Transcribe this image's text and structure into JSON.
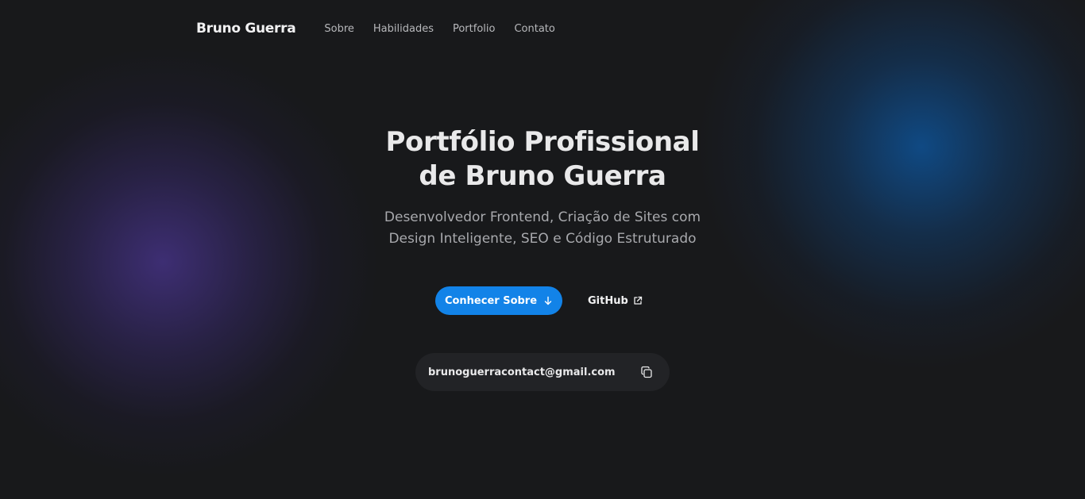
{
  "header": {
    "brand": "Bruno Guerra",
    "nav": [
      {
        "label": "Sobre"
      },
      {
        "label": "Habilidades"
      },
      {
        "label": "Portfolio"
      },
      {
        "label": "Contato"
      }
    ]
  },
  "hero": {
    "title_line1": "Portfólio Profissional",
    "title_line2": "de Bruno Guerra",
    "subtitle_line1": "Desenvolvedor Frontend, Criação de Sites com",
    "subtitle_line2": "Design Inteligente, SEO e Código Estruturado"
  },
  "actions": {
    "primary_label": "Conhecer Sobre",
    "primary_icon": "arrow-down-icon",
    "secondary_label": "GitHub",
    "secondary_icon": "external-link-icon"
  },
  "contact": {
    "email": "brunoguerracontact@gmail.com",
    "copy_icon": "copy-icon"
  },
  "colors": {
    "background": "#18191b",
    "accent": "#1283e8",
    "glow_left": "#48348c",
    "glow_right": "#0e5296"
  }
}
